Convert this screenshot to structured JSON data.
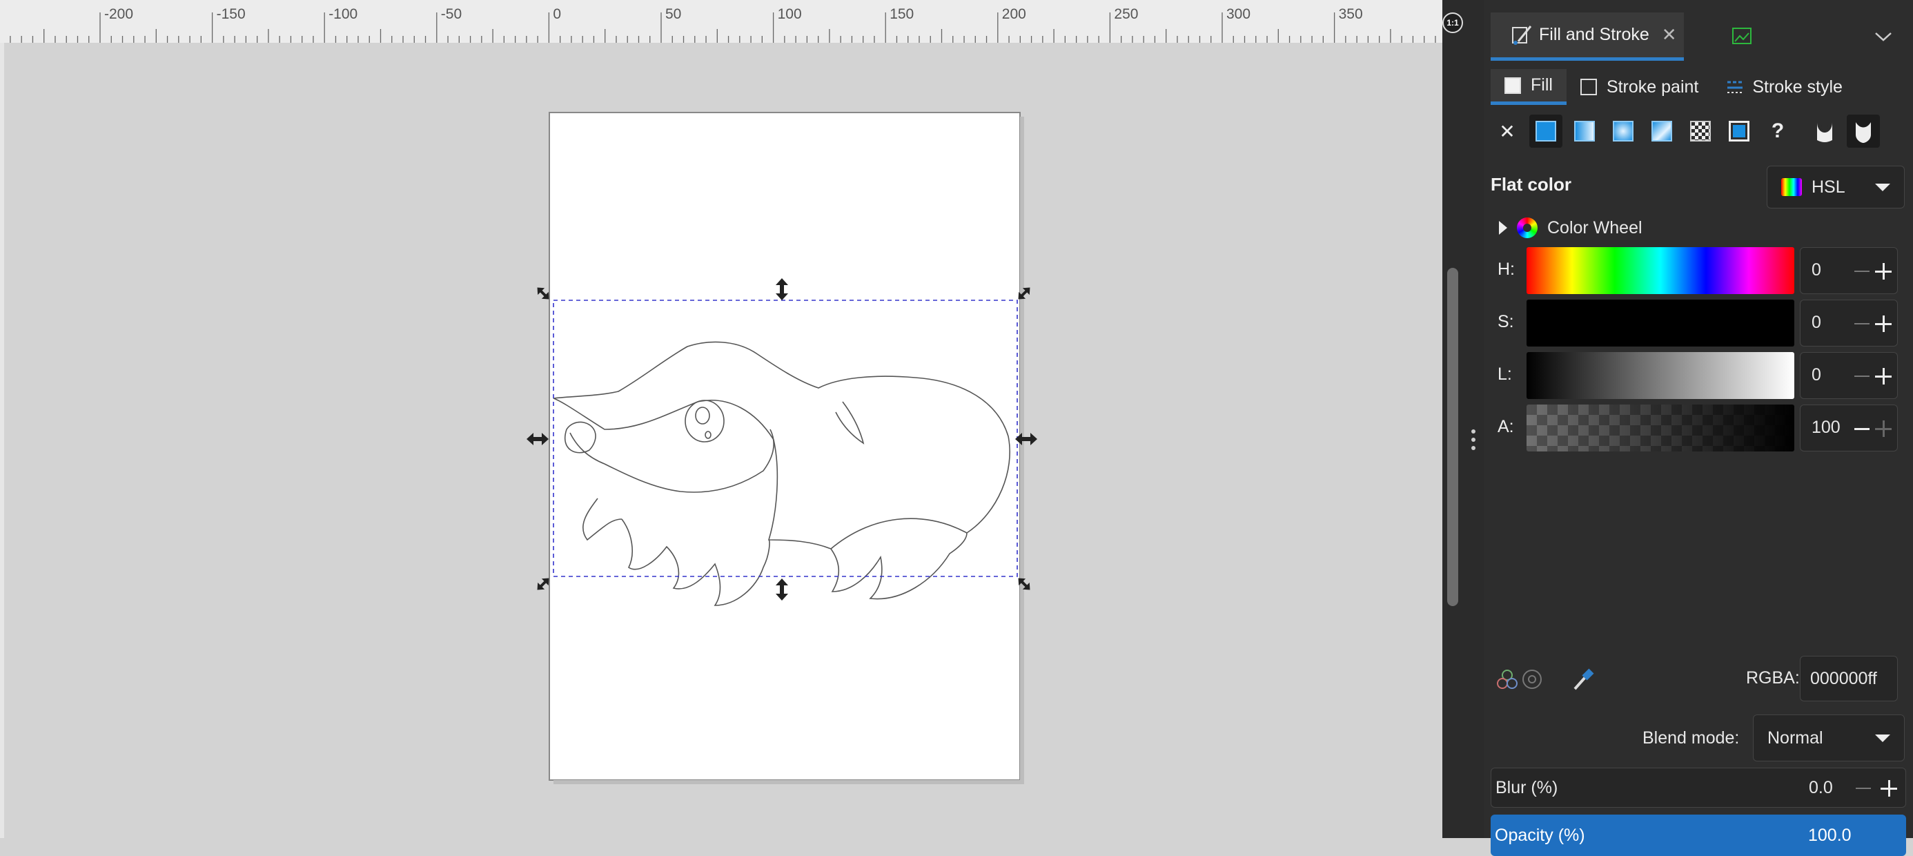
{
  "ruler": {
    "ticks": [
      "-200",
      "-150",
      "-100",
      "-50",
      "0",
      "50",
      "100",
      "150",
      "200",
      "250",
      "300",
      "350"
    ]
  },
  "corner_button": {
    "label": "1:1"
  },
  "panel": {
    "dock_tabs": {
      "fill_stroke": "Fill and Stroke",
      "export_icon": "export-image-icon"
    },
    "sub_tabs": {
      "fill": "Fill",
      "stroke_paint": "Stroke paint",
      "stroke_style": "Stroke style"
    },
    "paint_types": [
      "no-paint-icon",
      "flat-color-icon",
      "linear-gradient-icon",
      "radial-gradient-icon",
      "mesh-gradient-icon",
      "pattern-icon",
      "swatch-icon",
      "unset-paint-icon",
      "fill-rule-evenodd-icon",
      "fill-rule-nonzero-icon"
    ],
    "flat_color": "Flat color",
    "color_mode": "HSL",
    "color_wheel": "Color Wheel",
    "sliders": {
      "h": {
        "label": "H:",
        "value": "0"
      },
      "s": {
        "label": "S:",
        "value": "0"
      },
      "l": {
        "label": "L:",
        "value": "0"
      },
      "a": {
        "label": "A:",
        "value": "100"
      }
    },
    "rgba": {
      "label": "RGBA:",
      "value": "000000ff"
    },
    "blend": {
      "label": "Blend mode:",
      "value": "Normal"
    },
    "blur": {
      "label": "Blur (%)",
      "value": "0.0"
    },
    "opacity": {
      "label": "Opacity (%)",
      "value": "100.0"
    }
  },
  "colors": {
    "accent": "#2f7fc9",
    "panel_bg": "#2d2d2d",
    "canvas_bg": "#d3d3d3",
    "selection": "#3333cc"
  }
}
